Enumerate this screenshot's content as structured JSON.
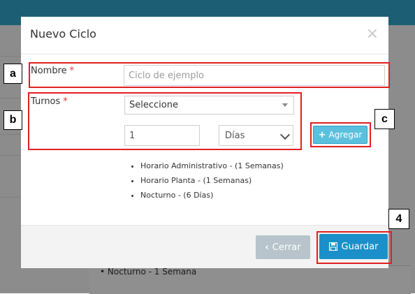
{
  "modal": {
    "title": "Nuevo Ciclo",
    "close_glyph": "×"
  },
  "form": {
    "nombre_label": "Nombre",
    "required_mark": "*",
    "nombre_placeholder": "Ciclo de ejemplo",
    "turnos_label": "Turnos",
    "turnos_select_value": "Seleccione",
    "cantidad_value": "1",
    "unidad_select_value": "Días",
    "agregar_label": "Agregar",
    "agregar_icon": "plus-icon"
  },
  "turnos_list": [
    "Horario Administrativo - (1 Semanas)",
    "Horario Planta - (1 Semanas)",
    "Nocturno - (6 Días)"
  ],
  "footer": {
    "cerrar_label": "Cerrar",
    "cerrar_icon": "chevron-left-icon",
    "guardar_label": "Guardar",
    "guardar_icon": "save-icon"
  },
  "background": {
    "list_item": "Nocturno - 1 Semana"
  },
  "annotations": {
    "a": "a",
    "b": "b",
    "c": "c",
    "d": "4"
  },
  "colors": {
    "header_bar": "#1c5f74",
    "annotation": "#e02020",
    "agregar_button": "#5bc0de",
    "guardar_button": "#1b8fc9",
    "cerrar_button": "#b7c4cc"
  }
}
